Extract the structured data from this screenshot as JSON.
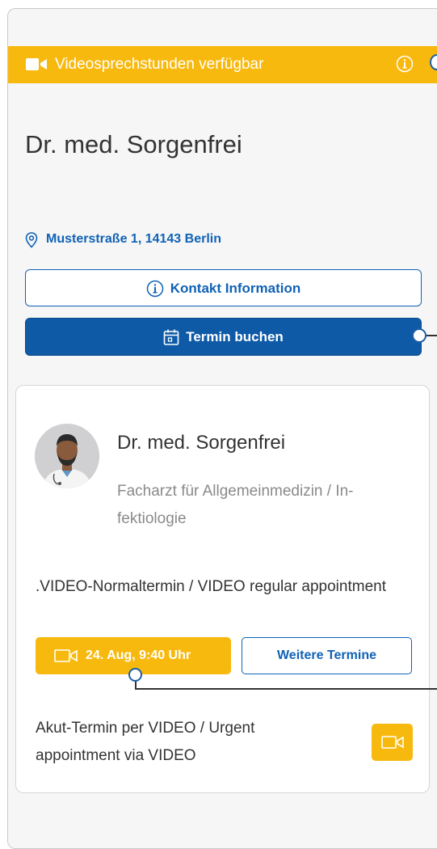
{
  "banner": {
    "text": "Videosprechstunden verfügbar",
    "icon": "video-camera-icon",
    "info_icon": "info-icon"
  },
  "doctor": {
    "name": "Dr. med. Sorgenfrei"
  },
  "address": {
    "text": "Musterstraße 1, 14143 Berlin",
    "icon": "location-pin-icon"
  },
  "buttons": {
    "contact": "Kontakt Information",
    "book": "Termin buchen"
  },
  "card": {
    "name": "Dr. med. Sorgenfrei",
    "specialty": "Facharzt für Allgemeinmedizin / In-fektiologie",
    "appointment_regular": ".VIDEO-Normaltermin / VIDEO regular appointment",
    "slot_label": "24. Aug, 9:40 Uhr",
    "more_label": "Weitere Termine",
    "appointment_urgent": "Akut-Termin per VIDEO / Urgent appointment via VIDEO"
  },
  "colors": {
    "accent_yellow": "#f8b90f",
    "primary_blue": "#0e5aa7",
    "link_blue": "#1062b5"
  }
}
